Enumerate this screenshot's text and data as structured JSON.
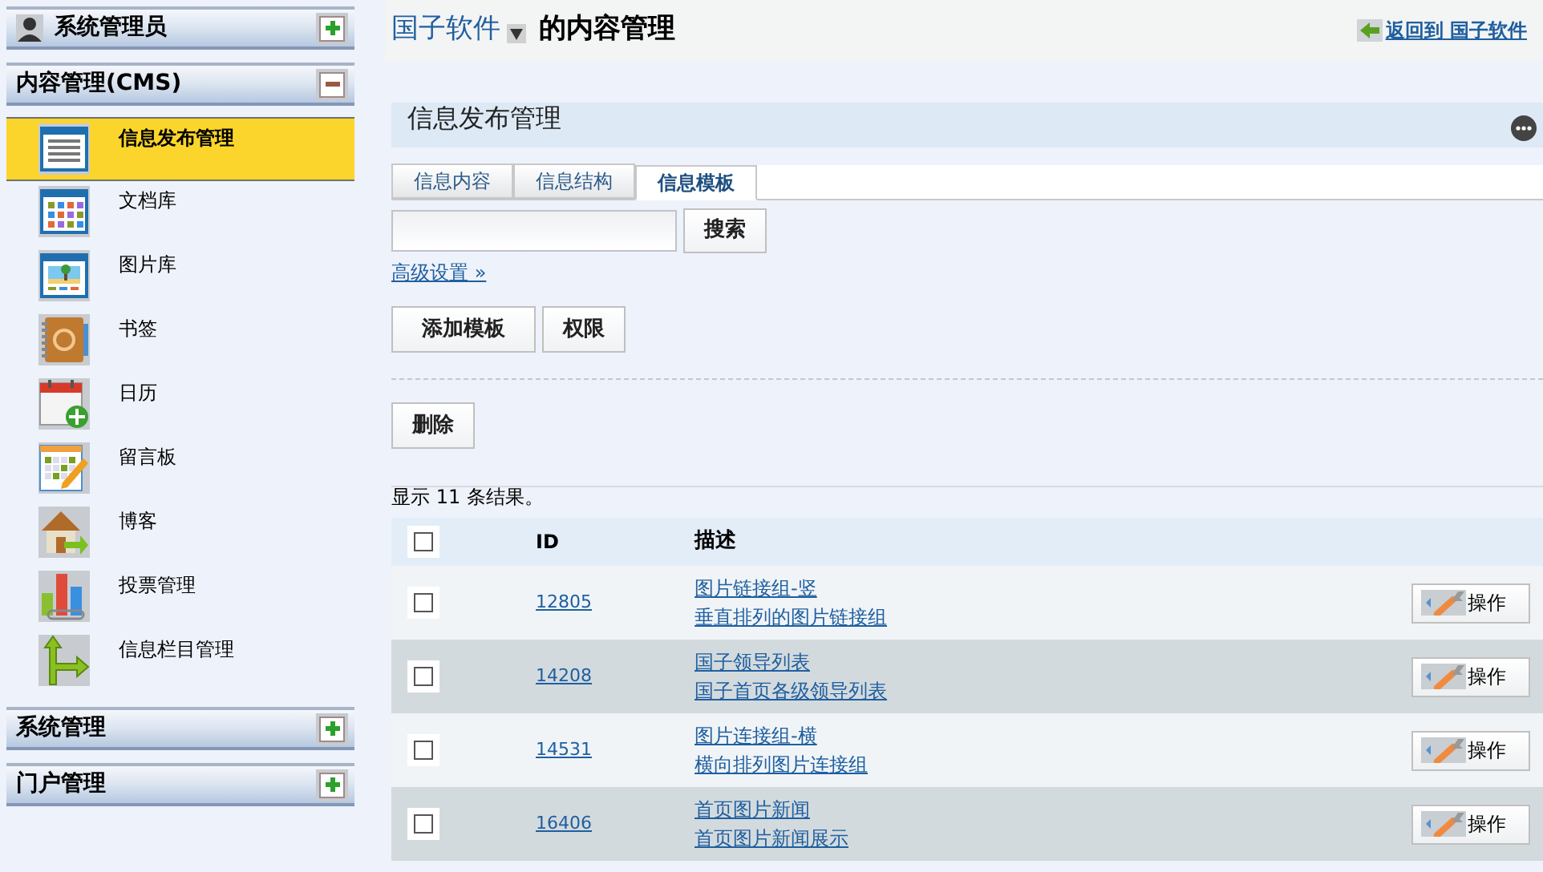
{
  "sidebar": {
    "sections": [
      {
        "title": "系统管理员",
        "kind": "user",
        "expanded": false
      },
      {
        "title": "内容管理(CMS)",
        "kind": "plain",
        "expanded": true,
        "items": [
          {
            "label": "信息发布管理",
            "selected": true
          },
          {
            "label": "文档库",
            "selected": false
          },
          {
            "label": "图片库",
            "selected": false
          },
          {
            "label": "书签",
            "selected": false
          },
          {
            "label": "日历",
            "selected": false
          },
          {
            "label": "留言板",
            "selected": false
          },
          {
            "label": "博客",
            "selected": false
          },
          {
            "label": "投票管理",
            "selected": false
          },
          {
            "label": "信息栏目管理",
            "selected": false
          }
        ]
      },
      {
        "title": "系统管理",
        "kind": "plain",
        "expanded": false
      },
      {
        "title": "门户管理",
        "kind": "plain",
        "expanded": false
      }
    ]
  },
  "header": {
    "site": "国子软件",
    "title": "的内容管理",
    "back_link": "返回到 国子软件"
  },
  "portlet": {
    "title": "信息发布管理",
    "tabs": [
      {
        "label": "信息内容",
        "selected": false
      },
      {
        "label": "信息结构",
        "selected": false
      },
      {
        "label": "信息模板",
        "selected": true
      }
    ],
    "search_button": "搜索",
    "advanced_link": "高级设置 »",
    "actions": [
      "添加模板",
      "权限"
    ],
    "bulk_actions": [
      "删除"
    ],
    "result_summary": "显示 11 条结果。",
    "table": {
      "columns": [
        "ID",
        "描述"
      ],
      "header_checked": false,
      "rows": [
        {
          "id": "12805",
          "name": "图片链接组-竖",
          "description": "垂直排列的图片链接组",
          "checked": false,
          "action": "操作"
        },
        {
          "id": "14208",
          "name": "国子领导列表",
          "description": "国子首页各级领导列表",
          "checked": false,
          "action": "操作"
        },
        {
          "id": "14531",
          "name": "图片连接组-横",
          "description": "横向排列图片连接组",
          "checked": false,
          "action": "操作"
        },
        {
          "id": "16406",
          "name": "首页图片新闻",
          "description": "首页图片新闻展示",
          "checked": false,
          "action": "操作"
        }
      ]
    }
  }
}
